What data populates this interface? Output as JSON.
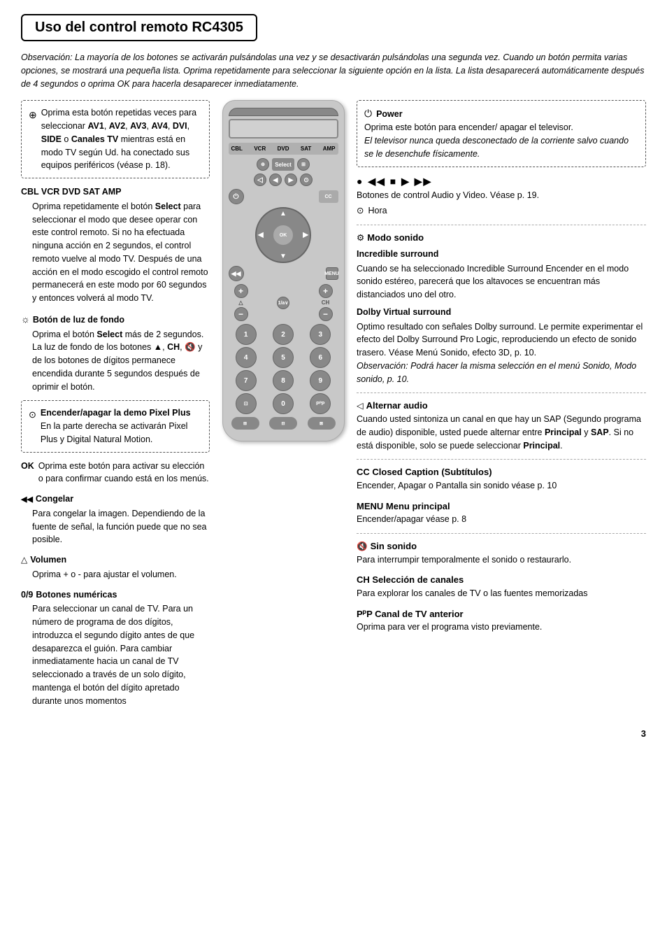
{
  "title": "Uso del control remoto RC4305",
  "observation": "Observación: La mayoría de los botones se activarán pulsándolas una vez y se desactivarán pulsándolas una segunda vez. Cuando un botón permita varias opciones, se mostrará una pequeña lista. Oprima repetidamente para seleccionar la siguiente opción en la lista. La lista desaparecerá automáticamente después de 4 segundos o oprima OK para hacerla desaparecer inmediatamente.",
  "left": {
    "box1_lines": [
      "Oprima esta botón repetidas",
      "veces para seleccionar AV1, AV2,",
      "AV3, AV4, DVI, SIDE o Canales",
      "TV mientras está en modo TV",
      "según Ud. ha conectado sus",
      "equipos periféricos (véase p. 18)."
    ],
    "cbl_title": "CBL VCR DVD SAT AMP",
    "cbl_text": "Oprima repetidamente el botón Select para seleccionar el modo que desee operar con este control remoto. Si no ha efectuada ninguna acción en 2 segundos, el control remoto vuelve al modo TV. Después de una acción en el modo escogido el control remoto permanecerá en este modo por 60 segundos y entonces volverá al modo TV.",
    "backlight_title": "Botón de luz de fondo",
    "backlight_icon": "☼",
    "backlight_text": "Oprima el botón Select más de 2 segundos. La luz de fondo de los botones ▲, CH, 🔇 y de los botones de dígitos permanece encendida durante 5 segundos después de oprimir el botón.",
    "box2_title": "Encender/apagar la demo Pixel Plus",
    "box2_icon": "⊙",
    "box2_text": "En la parte derecha se activarán Pixel Plus y Digital Natural Motion.",
    "ok_title": "OK",
    "ok_text": "Oprima este botón para activar su elección o para confirmar cuando está en los menús.",
    "freeze_title": "Congelar",
    "freeze_icon": "◀◀",
    "freeze_text": "Para congelar la imagen. Dependiendo de la fuente de señal, la función puede que no sea posible.",
    "volume_title": "Volumen",
    "volume_icon": "△",
    "volume_text": "Oprima + o - para ajustar el volumen.",
    "numeric_title": "Botones numéricas",
    "numeric_label": "0/9",
    "numeric_text": "Para seleccionar un canal de TV. Para un número de programa de dos dígitos, introduzca el segundo dígito antes de que desaparezca el guión. Para cambiar inmediatamente hacia un canal de TV seleccionado a través de un solo dígito, mantenga el botón del dígito apretado durante unos momentos"
  },
  "right": {
    "power_title": "Power",
    "power_icon": "⏻",
    "power_text": "Oprima este botón para encender/ apagar el televisor.",
    "power_note": "El televisor nunca queda desconectado de la corriente salvo cuando se le desenchufe físicamente.",
    "media_icons": "● ◀◀ ■ ▶ ▶▶",
    "media_text": "Botones de control Audio y Video. Véase p. 19.",
    "hora_icon": "⊙",
    "hora_label": "Hora",
    "sound_mode_title": "Modo sonido",
    "sound_mode_icon": "⚙",
    "incredible_title": "Incredible surround",
    "incredible_text": "Cuando se ha seleccionado Incredible Surround Encender en el modo sonido estéreo, parecerá que los altavoces se encuentran más distanciados uno del otro.",
    "dolby_title": "Dolby Virtual surround",
    "dolby_text": "Optimo resultado con señales Dolby surround. Le permite experimentar el efecto del Dolby Surround Pro Logic, reproduciendo un efecto de sonido trasero. Véase Menú Sonido, efecto 3D, p. 10.",
    "dolby_note": "Observación: Podrá hacer la misma selección en el menú Sonido, Modo sonido, p. 10.",
    "alt_audio_title": "Alternar audio",
    "alt_audio_icon": "◁",
    "alt_audio_text1": "Cuando usted sintoniza un canal en que hay un SAP (Segundo programa de audio) disponible, usted puede alternar entre",
    "alt_audio_bold1": "Principal",
    "alt_audio_text2": " y ",
    "alt_audio_bold2": "SAP",
    "alt_audio_text3": ". Si no está disponible, solo se puede seleccionar ",
    "alt_audio_bold3": "Principal",
    "alt_audio_text4": ".",
    "cc_title": "CC  Closed Caption (Subtítulos)",
    "cc_text": "Encender, Apagar o Pantalla sin sonido  véase p. 10",
    "menu_title": "MENU   Menu principal",
    "menu_text": "Encender/apagar  véase p. 8",
    "mute_title": "Sin sonido",
    "mute_icon": "🔇",
    "mute_text": "Para interrumpir temporalmente el sonido o restaurarlo.",
    "ch_sel_title": "CH   Selección de canales",
    "ch_sel_text": "Para explorar los canales de TV o las fuentes memorizadas",
    "pip_title": "PᴾP  Canal de TV anterior",
    "pip_text": "Oprima para ver el programa visto previamente."
  },
  "remote": {
    "mode_buttons": [
      "CBL",
      "VCR",
      "DVD",
      "SAT",
      "AMP"
    ],
    "num_buttons": [
      "1",
      "2",
      "3",
      "4",
      "5",
      "6",
      "7",
      "8",
      "9",
      "⊡",
      "0",
      "PᴾP"
    ]
  },
  "page_number": "3"
}
